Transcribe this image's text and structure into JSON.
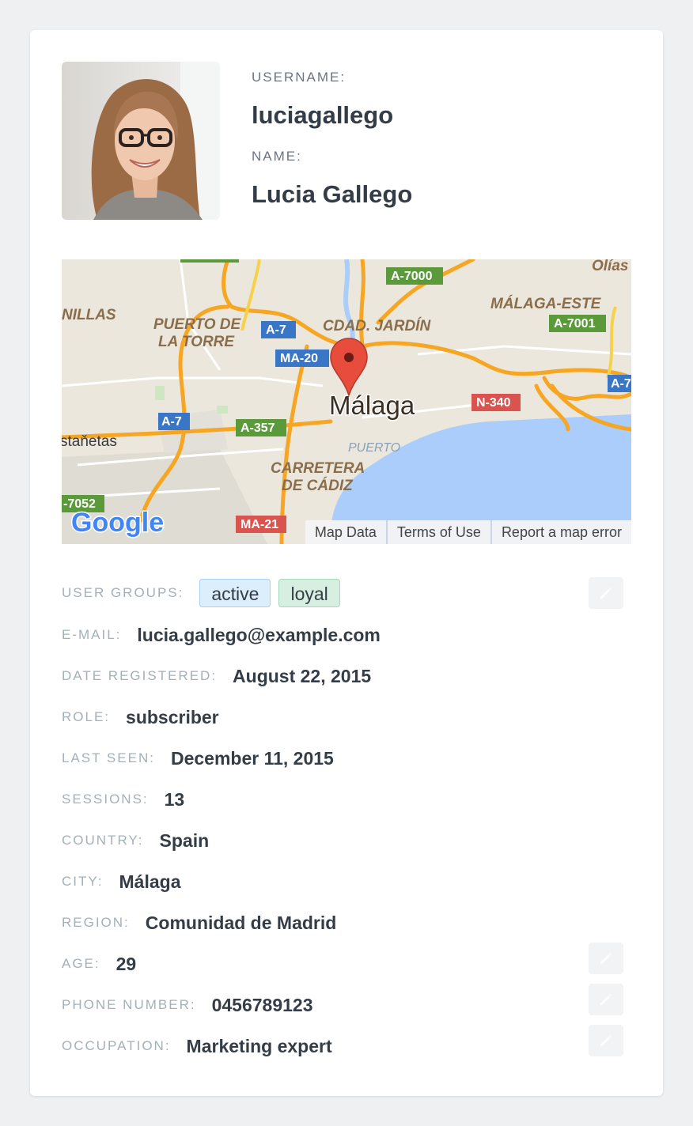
{
  "profile": {
    "username_label": "USERNAME:",
    "username": "luciagallego",
    "name_label": "NAME:",
    "name": "Lucia Gallego"
  },
  "map": {
    "city_label": "Málaga",
    "places": {
      "olias": "Olías",
      "malaga_este": "MÁLAGA-ESTE",
      "nillas": "NILLAS",
      "puerto_torre_1": "PUERTO DE",
      "puerto_torre_2": "LA TORRE",
      "cdad_jardin": "CDAD. JARDÍN",
      "castanetas": "staňetas",
      "puerto": "PUERTO",
      "carretera_1": "CARRETERA",
      "carretera_2": "DE CÁDIZ"
    },
    "roads": {
      "a7000": "A-7000",
      "a7001": "A-7001",
      "a7_1": "A-7",
      "ma20": "MA-20",
      "n340": "N-340",
      "a7_2": "A-7",
      "a357": "A-357",
      "a7052": "-7052",
      "ma21": "MA-21",
      "a7_edge": "A-7"
    },
    "google_logo": "Google",
    "footer": {
      "map_data": "Map Data",
      "terms": "Terms of Use",
      "report": "Report a map error"
    }
  },
  "details": {
    "user_groups_label": "USER GROUPS:",
    "groups": [
      "active",
      "loyal"
    ],
    "email_label": "E-MAIL:",
    "email": "lucia.gallego@example.com",
    "date_registered_label": "DATE REGISTERED:",
    "date_registered": "August 22, 2015",
    "role_label": "ROLE:",
    "role": "subscriber",
    "last_seen_label": "LAST SEEN:",
    "last_seen": "December 11, 2015",
    "sessions_label": "SESSIONS:",
    "sessions": "13",
    "country_label": "COUNTRY:",
    "country": "Spain",
    "city_label": "CITY:",
    "city": "Málaga",
    "region_label": "REGION:",
    "region": "Comunidad de Madrid",
    "age_label": "AGE:",
    "age": "29",
    "phone_label": "PHONE NUMBER:",
    "phone": "0456789123",
    "occupation_label": "OCCUPATION:",
    "occupation": "Marketing expert"
  },
  "colors": {
    "accent_blue_tag": "#dcedfb",
    "accent_green_tag": "#d7efe1",
    "value_text": "#343d47",
    "label_text": "#a3b1b7"
  }
}
